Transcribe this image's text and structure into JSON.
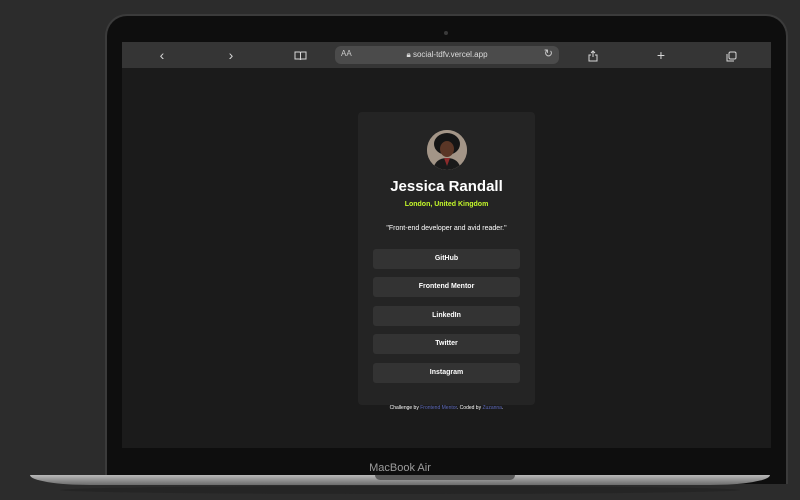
{
  "device": {
    "label": "MacBook Air"
  },
  "browser": {
    "address": "social-tdfv.vercel.app",
    "text_size_label": "AA"
  },
  "profile": {
    "name": "Jessica Randall",
    "location": "London, United Kingdom",
    "bio": "\"Front-end developer and avid reader.\"",
    "links": [
      {
        "label": "GitHub"
      },
      {
        "label": "Frontend Mentor"
      },
      {
        "label": "LinkedIn"
      },
      {
        "label": "Twitter"
      },
      {
        "label": "Instagram"
      }
    ]
  },
  "attribution": {
    "prefix": "Challenge by ",
    "challenge_link": "Frontend Mentor",
    "middle": ". Coded by ",
    "author_link": "Zuzanna",
    "suffix": "."
  },
  "colors": {
    "accent": "#c4f82a",
    "card": "#242424",
    "button": "#333333",
    "page": "#1b1b1b"
  },
  "icons": [
    "back-icon",
    "forward-icon",
    "bookmarks-icon",
    "lock-icon",
    "reload-icon",
    "share-icon",
    "new-tab-icon",
    "tabs-icon"
  ]
}
